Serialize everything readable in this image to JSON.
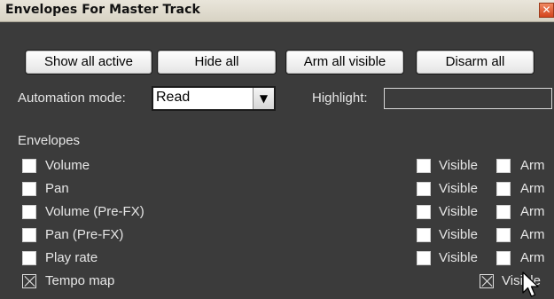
{
  "window": {
    "title": "Envelopes For Master Track",
    "close_glyph": "✕"
  },
  "toolbar": {
    "show_all_active": "Show all active",
    "hide_all": "Hide all",
    "arm_all_visible": "Arm all visible",
    "disarm_all": "Disarm all"
  },
  "automation": {
    "label": "Automation mode:",
    "value": "Read",
    "arrow_glyph": "▼"
  },
  "highlight": {
    "label": "Highlight:",
    "value": ""
  },
  "envelopes": {
    "heading": "Envelopes",
    "items": [
      {
        "label": "Volume",
        "checked": false,
        "visible_label": "Visible",
        "visible_checked": false,
        "arm_label": "Arm",
        "arm_checked": false
      },
      {
        "label": "Pan",
        "checked": false,
        "visible_label": "Visible",
        "visible_checked": false,
        "arm_label": "Arm",
        "arm_checked": false
      },
      {
        "label": "Volume (Pre-FX)",
        "checked": false,
        "visible_label": "Visible",
        "visible_checked": false,
        "arm_label": "Arm",
        "arm_checked": false
      },
      {
        "label": "Pan (Pre-FX)",
        "checked": false,
        "visible_label": "Visible",
        "visible_checked": false,
        "arm_label": "Arm",
        "arm_checked": false
      },
      {
        "label": "Play rate",
        "checked": false,
        "visible_label": "Visible",
        "visible_checked": false,
        "arm_label": "Arm",
        "arm_checked": false
      },
      {
        "label": "Tempo map",
        "checked": true,
        "visible_label": "Visible",
        "visible_checked": true
      }
    ]
  },
  "icons": {
    "close": "close-icon",
    "dropdown": "chevron-down-icon",
    "cursor": "mouse-pointer-icon"
  },
  "colors": {
    "background": "#3b3b3b",
    "titlebar": "#e2ded2",
    "text": "#e6e6e6",
    "close": "#e0562c"
  }
}
